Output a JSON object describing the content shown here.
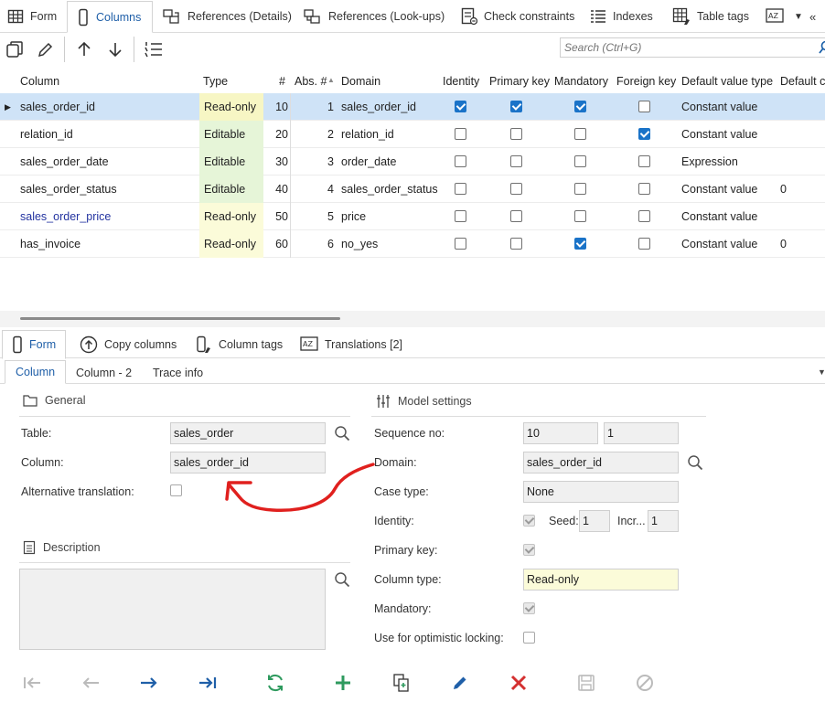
{
  "top_tabs": [
    {
      "label": "Form",
      "icon": "grid-icon"
    },
    {
      "label": "Columns",
      "icon": "column-icon"
    },
    {
      "label": "References (Details)",
      "icon": "references-icon"
    },
    {
      "label": "References (Look-ups)",
      "icon": "lookup-icon"
    },
    {
      "label": "Check constraints",
      "icon": "check-constraint-icon"
    },
    {
      "label": "Indexes",
      "icon": "index-icon"
    },
    {
      "label": "Table tags",
      "icon": "table-tag-icon"
    }
  ],
  "toolbar": {
    "search_placeholder": "Search (Ctrl+G)"
  },
  "grid": {
    "headers": {
      "column": "Column",
      "type": "Type",
      "num": "#",
      "abs": "Abs. #",
      "domain": "Domain",
      "identity": "Identity",
      "primary_key": "Primary key",
      "mandatory": "Mandatory",
      "foreign_key": "Foreign key",
      "default_value_type": "Default value type",
      "default_c": "Default c"
    },
    "rows": [
      {
        "column": "sales_order_id",
        "type": "Read-only",
        "num": "10",
        "abs": "1",
        "domain": "sales_order_id",
        "identity": true,
        "primary_key": true,
        "mandatory": true,
        "foreign_key": false,
        "default_value_type": "Constant value",
        "default": ""
      },
      {
        "column": "relation_id",
        "type": "Editable",
        "num": "20",
        "abs": "2",
        "domain": "relation_id",
        "identity": false,
        "primary_key": false,
        "mandatory": false,
        "foreign_key": true,
        "default_value_type": "Constant value",
        "default": ""
      },
      {
        "column": "sales_order_date",
        "type": "Editable",
        "num": "30",
        "abs": "3",
        "domain": "order_date",
        "identity": false,
        "primary_key": false,
        "mandatory": false,
        "foreign_key": false,
        "default_value_type": "Expression",
        "default": ""
      },
      {
        "column": "sales_order_status",
        "type": "Editable",
        "num": "40",
        "abs": "4",
        "domain": "sales_order_status",
        "identity": false,
        "primary_key": false,
        "mandatory": false,
        "foreign_key": false,
        "default_value_type": "Constant value",
        "default": "0"
      },
      {
        "column": "sales_order_price",
        "type": "Read-only",
        "num": "50",
        "abs": "5",
        "domain": "price",
        "identity": false,
        "primary_key": false,
        "mandatory": false,
        "foreign_key": false,
        "default_value_type": "Constant value",
        "default": ""
      },
      {
        "column": "has_invoice",
        "type": "Read-only",
        "num": "60",
        "abs": "6",
        "domain": "no_yes",
        "identity": false,
        "primary_key": false,
        "mandatory": true,
        "foreign_key": false,
        "default_value_type": "Constant value",
        "default": "0"
      }
    ]
  },
  "bottom_tabs": [
    {
      "label": "Form"
    },
    {
      "label": "Copy columns"
    },
    {
      "label": "Column tags"
    },
    {
      "label": "Translations [2]"
    }
  ],
  "sub_tabs": [
    "Column",
    "Column - 2",
    "Trace info"
  ],
  "form": {
    "general_title": "General",
    "table_label": "Table:",
    "table_value": "sales_order",
    "column_label": "Column:",
    "column_value": "sales_order_id",
    "alt_translation_label": "Alternative translation:",
    "description_title": "Description",
    "model_title": "Model settings",
    "sequence_label": "Sequence no:",
    "sequence_value": "10",
    "sequence_value2": "1",
    "domain_label": "Domain:",
    "domain_value": "sales_order_id",
    "case_type_label": "Case type:",
    "case_type_value": "None",
    "identity_label": "Identity:",
    "seed_label": "Seed:",
    "seed_value": "1",
    "incr_label": "Incr...",
    "incr_value": "1",
    "primary_key_label": "Primary key:",
    "column_type_label": "Column type:",
    "column_type_value": "Read-only",
    "mandatory_label": "Mandatory:",
    "optimistic_label": "Use for optimistic locking:"
  },
  "colors": {
    "accent": "#1a73c8",
    "annotation": "#e0201e",
    "readonly": "#fbfbd9",
    "editable": "#e6f5d8",
    "selected": "#cfe3f7"
  }
}
